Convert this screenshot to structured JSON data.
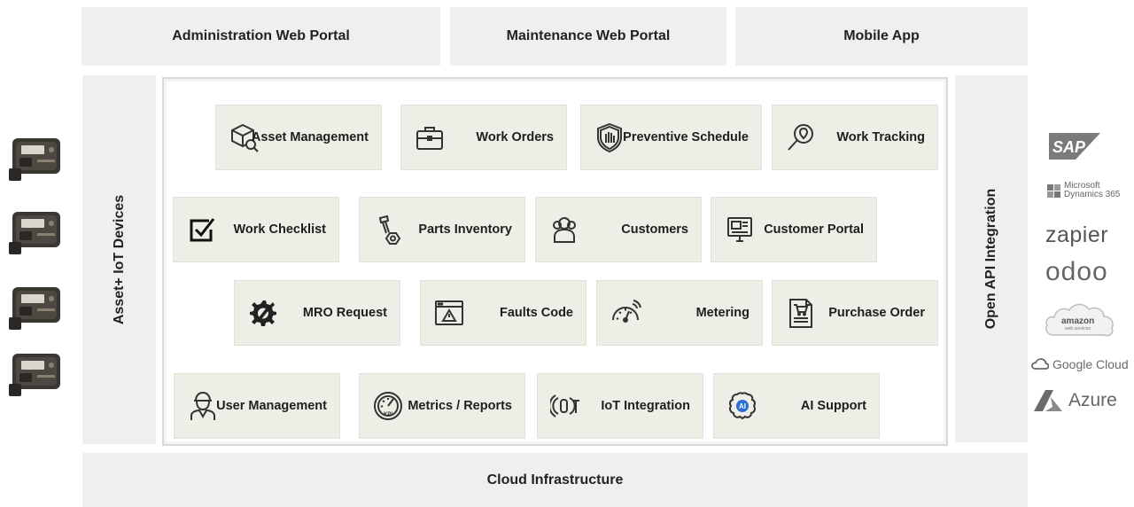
{
  "top": {
    "admin": "Administration Web Portal",
    "maintenance": "Maintenance Web Portal",
    "mobile": "Mobile App"
  },
  "left_label": "Asset+ IoT Devices",
  "right_label": "Open API Integration",
  "bottom_label": "Cloud Infrastructure",
  "modules": {
    "asset_management": "Asset Management",
    "work_orders": "Work Orders",
    "preventive_schedule": "Preventive Schedule",
    "work_tracking": "Work Tracking",
    "work_checklist": "Work Checklist",
    "parts_inventory": "Parts Inventory",
    "customers": "Customers",
    "customer_portal": "Customer Portal",
    "mro_request": "MRO Request",
    "faults_code": "Faults Code",
    "metering": "Metering",
    "purchase_order": "Purchase Order",
    "user_management": "User Management",
    "metrics_reports": "Metrics / Reports",
    "iot_integration": "IoT Integration",
    "ai_support": "AI Support"
  },
  "integrations": {
    "sap": "SAP",
    "microsoft_line1": "Microsoft",
    "microsoft_line2": "Dynamics 365",
    "zapier": "zapier",
    "odoo": "odoo",
    "amazon": "amazon",
    "amazon_sub": "web services",
    "google": "Google Cloud",
    "azure": "Azure"
  },
  "icons": {
    "asset_management": "box-search-icon",
    "work_orders": "briefcase-icon",
    "preventive_schedule": "shield-hand-icon",
    "work_tracking": "magnifier-pin-icon",
    "work_checklist": "checkbox-icon",
    "parts_inventory": "bolt-nut-icon",
    "customers": "people-icon",
    "customer_portal": "monitor-icon",
    "mro_request": "wrench-gear-icon",
    "faults_code": "warning-window-icon",
    "metering": "gauge-icon",
    "purchase_order": "cart-document-icon",
    "user_management": "worker-icon",
    "metrics_reports": "kpi-gauge-icon",
    "iot_integration": "iot-signal-icon",
    "ai_support": "ai-brain-icon"
  }
}
